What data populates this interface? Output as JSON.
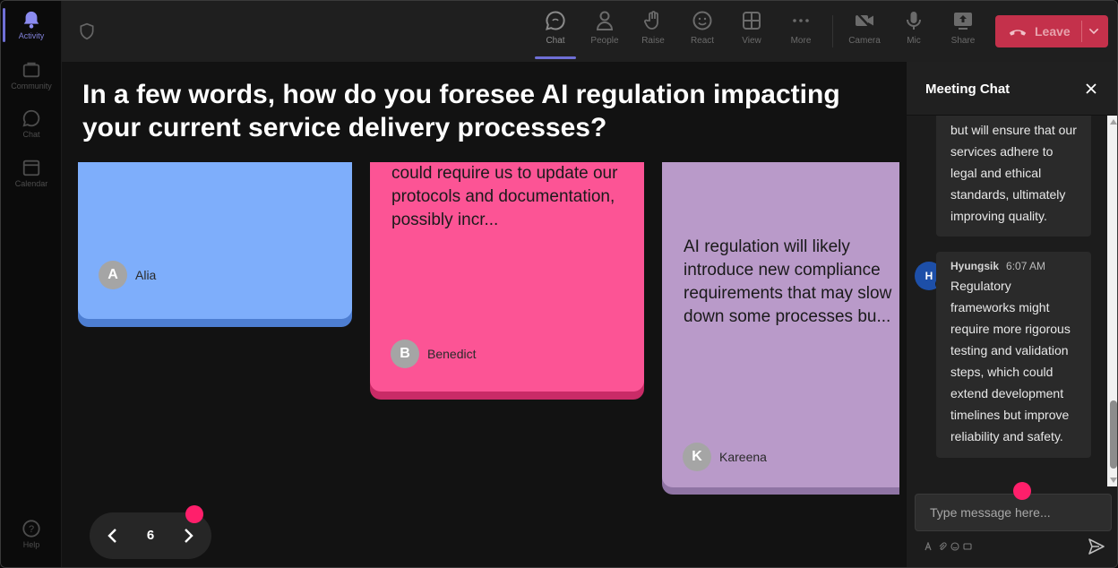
{
  "rail": {
    "items": [
      {
        "label": "Activity",
        "icon": "bell-icon"
      },
      {
        "label": "Community",
        "icon": "community-icon"
      },
      {
        "label": "Chat",
        "icon": "chat-icon"
      },
      {
        "label": "Calendar",
        "icon": "calendar-icon"
      },
      {
        "label": "Help",
        "icon": "help-icon"
      }
    ]
  },
  "toolbar": {
    "chat": "Chat",
    "people": "People",
    "raise": "Raise",
    "react": "React",
    "view": "View",
    "more": "More",
    "camera": "Camera",
    "mic": "Mic",
    "share": "Share",
    "leave": "Leave"
  },
  "question": "In a few words, how do you foresee AI regulation impacting your current service delivery processes?",
  "cards": [
    {
      "text": "",
      "author": "Alia",
      "initial": "A",
      "color": "#7eaefb"
    },
    {
      "text": "could require us to update our protocols and documentation, possibly incr...",
      "author": "Benedict",
      "initial": "B",
      "color": "#fc5495"
    },
    {
      "text": "AI regulation will likely introduce new compliance requirements that may slow down some processes bu...",
      "author": "Kareena",
      "initial": "K",
      "color": "#b99ac9"
    }
  ],
  "pager": {
    "page": "6"
  },
  "chat": {
    "title": "Meeting Chat",
    "messages": [
      {
        "text": "but will ensure that our services adhere to legal and ethical standards, ultimately improving quality."
      },
      {
        "author": "Hyungsik",
        "time": "6:07 AM",
        "initial": "H",
        "text": "Regulatory frameworks might require more rigorous testing and validation steps, which could extend development timelines but improve reliability and safety."
      }
    ],
    "input_placeholder": "Type message here..."
  },
  "colors": {
    "accent": "#6f6fd6",
    "leave": "#c4314b",
    "indicator": "#ff1f6b"
  }
}
